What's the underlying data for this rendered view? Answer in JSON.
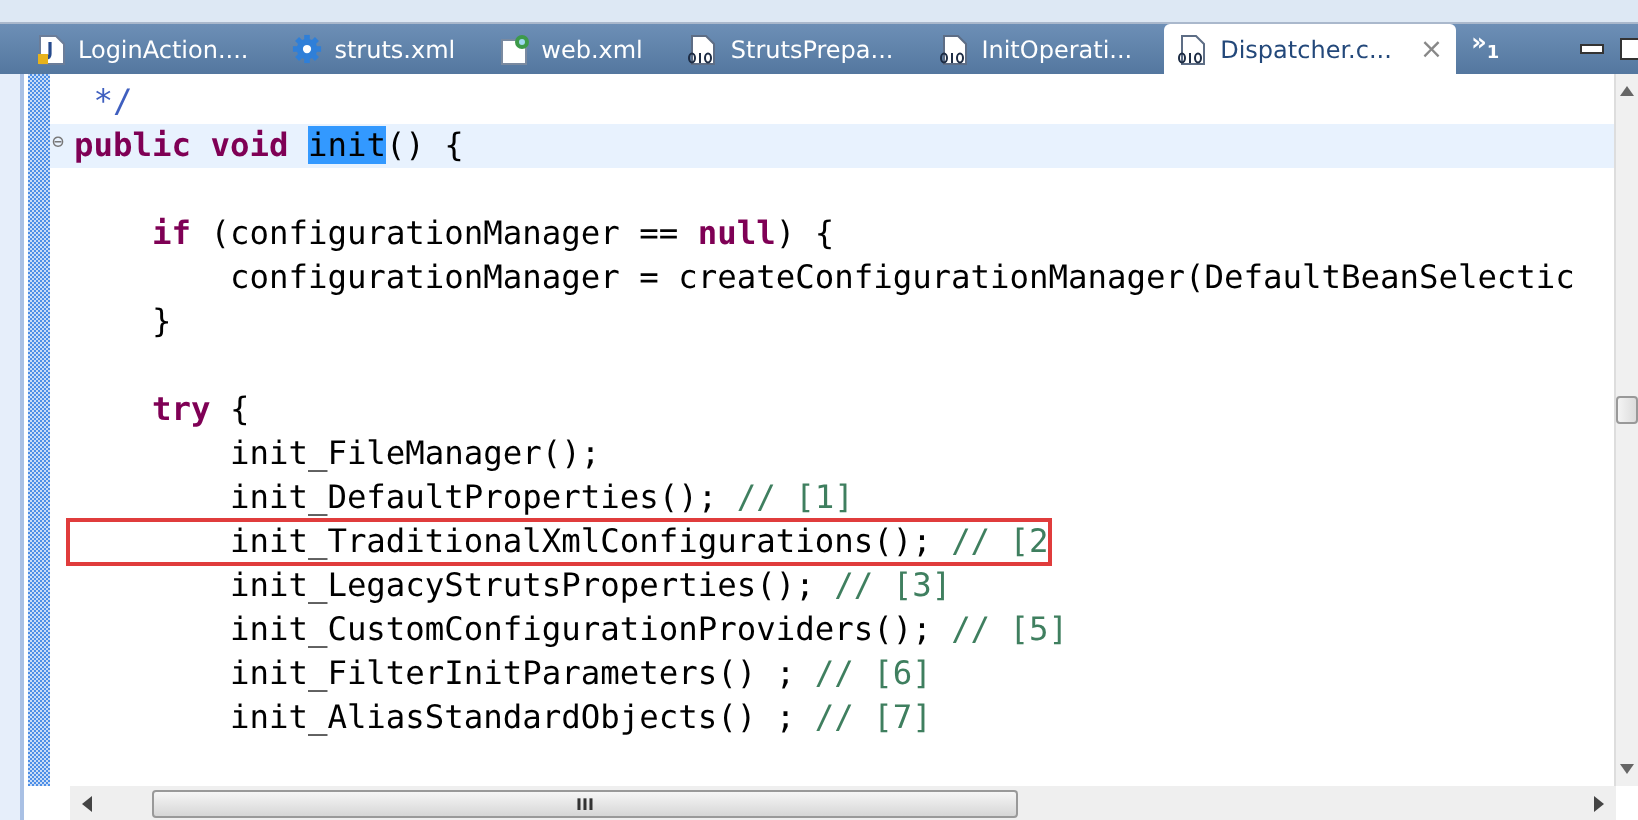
{
  "tabs": [
    {
      "label": "LoginAction....",
      "kind": "java",
      "selected": false,
      "closable": false
    },
    {
      "label": "struts.xml",
      "kind": "gear",
      "selected": false,
      "closable": false
    },
    {
      "label": "web.xml",
      "kind": "web",
      "selected": false,
      "closable": false
    },
    {
      "label": "StrutsPrepa...",
      "kind": "class",
      "selected": false,
      "closable": false
    },
    {
      "label": "InitOperati...",
      "kind": "class",
      "selected": false,
      "closable": false
    },
    {
      "label": "Dispatcher.c...",
      "kind": "class",
      "selected": true,
      "closable": true
    }
  ],
  "tab_overflow": {
    "glyph": "»",
    "count": "1"
  },
  "close_glyph": "×",
  "fold_glyph": "⊖",
  "code_lines": [
    {
      "current": false,
      "tokens": [
        {
          "kind": "comment",
          "text": " */"
        }
      ]
    },
    {
      "current": true,
      "folded": true,
      "tokens": [
        {
          "kind": "keyword",
          "text": "public void "
        },
        {
          "kind": "occurrence",
          "text": "init"
        },
        {
          "kind": "plain",
          "text": "() {"
        }
      ]
    },
    {
      "current": false
    },
    {
      "current": false,
      "tokens": [
        {
          "kind": "keyword",
          "text": "    if"
        },
        {
          "kind": "plain",
          "text": " (configurationManager == "
        },
        {
          "kind": "keyword",
          "text": "null"
        },
        {
          "kind": "plain",
          "text": ") {"
        }
      ]
    },
    {
      "current": false,
      "tokens": [
        {
          "kind": "plain",
          "text": "        configurationManager = createConfigurationManager(DefaultBeanSelectic"
        }
      ]
    },
    {
      "current": false,
      "tokens": [
        {
          "kind": "plain",
          "text": "    }"
        }
      ]
    },
    {
      "current": false
    },
    {
      "current": false,
      "tokens": [
        {
          "kind": "keyword",
          "text": "    try"
        },
        {
          "kind": "plain",
          "text": " {"
        }
      ]
    },
    {
      "current": false,
      "tokens": [
        {
          "kind": "plain",
          "text": "        init_FileManager();"
        }
      ]
    },
    {
      "current": false,
      "tokens": [
        {
          "kind": "plain",
          "text": "        init_DefaultProperties(); "
        },
        {
          "kind": "linecomment",
          "text": "// [1]"
        }
      ]
    },
    {
      "current": false,
      "boxed": true,
      "tokens": [
        {
          "kind": "plain",
          "text": "        init_TraditionalXmlConfigurations(); "
        },
        {
          "kind": "linecomment",
          "text": "// [2"
        }
      ]
    },
    {
      "current": false,
      "tokens": [
        {
          "kind": "plain",
          "text": "        init_LegacyStrutsProperties(); "
        },
        {
          "kind": "linecomment",
          "text": "// [3]"
        }
      ]
    },
    {
      "current": false,
      "tokens": [
        {
          "kind": "plain",
          "text": "        init_CustomConfigurationProviders(); "
        },
        {
          "kind": "linecomment",
          "text": "// [5]"
        }
      ]
    },
    {
      "current": false,
      "tokens": [
        {
          "kind": "plain",
          "text": "        init_FilterInitParameters() ; "
        },
        {
          "kind": "linecomment",
          "text": "// [6]"
        }
      ]
    },
    {
      "current": false,
      "tokens": [
        {
          "kind": "plain",
          "text": "        init_AliasStandardObjects() ; "
        },
        {
          "kind": "linecomment",
          "text": "// [7]"
        }
      ]
    },
    {
      "current": false
    }
  ],
  "hscroll_grip": "III"
}
